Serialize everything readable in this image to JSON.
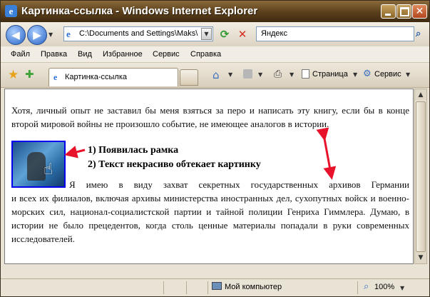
{
  "window": {
    "title": "Картинка-ссылка - Windows Internet Explorer",
    "close_glyph": "✕"
  },
  "address_bar": {
    "url": "C:\\Documents and Settings\\Maks\\P",
    "search_value": "Яндекс"
  },
  "menu": {
    "items": [
      "Файл",
      "Правка",
      "Вид",
      "Избранное",
      "Сервис",
      "Справка"
    ]
  },
  "tabs": [
    {
      "label": "Картинка-ссылка"
    }
  ],
  "command_bar": {
    "page_label": "Страница",
    "tools_label": "Сервис"
  },
  "content": {
    "paragraph1": "Хотя, личный опыт не заставил бы меня взяться за перо и написать эту книгу, если бы в конце второй мировой войны не произошло событие, не имеющее аналогов в истории.",
    "annotation1": "1) Появилась рамка",
    "annotation2": "2) Текст некрасиво обтекает картинку",
    "paragraph2_first_line": "Я имею в виду захват секретных государственных архивов Германии",
    "paragraph2_rest": "и всех их филиалов, включая архивы министерства иностранных дел, сухопутных войск и военно-морских сил, национал-социалистской партии и тайной полиции Генриха Гиммлера. Думаю, в истории не было прецедентов, когда столь ценные материалы попадали в руки современных исследователей."
  },
  "status_bar": {
    "zone": "Мой компьютер",
    "zoom": "100%"
  },
  "colors": {
    "annotation_arrow": "#e8132a",
    "link_border": "#0000ee"
  }
}
